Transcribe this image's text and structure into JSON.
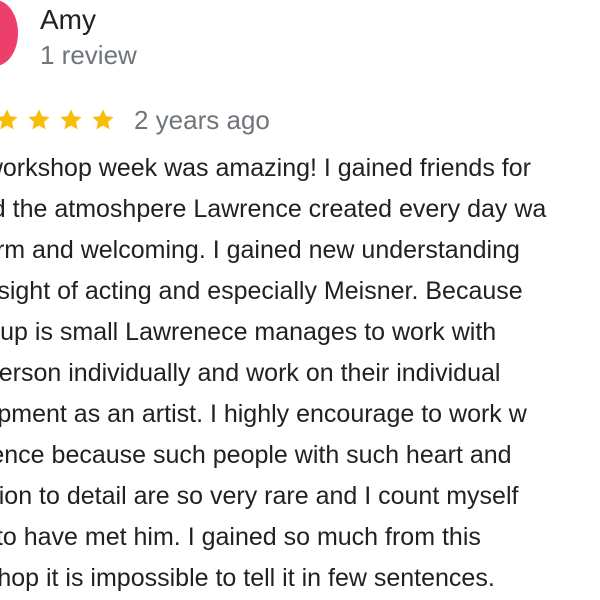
{
  "reviewer": {
    "name": "Amy",
    "review_count": "1 review",
    "avatar_color": "#ee3f6b"
  },
  "rating": {
    "stars_visible": 4,
    "star_color": "#fbbc04",
    "date": "2 years ago"
  },
  "review": {
    "lines": [
      "e workshop week was amazing! I gained friends for",
      "and the atmoshpere Lawrence created every day wa",
      "warm and welcoming. I gained new understanding",
      "t insight of acting and especially Meisner. Because",
      "group is small Lawrenece manages to work with",
      "h person individually and work on their individual",
      "elopment as an artist. I highly encourage to work w",
      "wrence because such people with such heart and",
      "ention to detail are so very rare and I count myself",
      "ky to have met him. I gained so much from this",
      "rkshop it is impossible to tell it in few sentences."
    ]
  },
  "colors": {
    "primary_text": "#202124",
    "secondary_text": "#70757a"
  }
}
